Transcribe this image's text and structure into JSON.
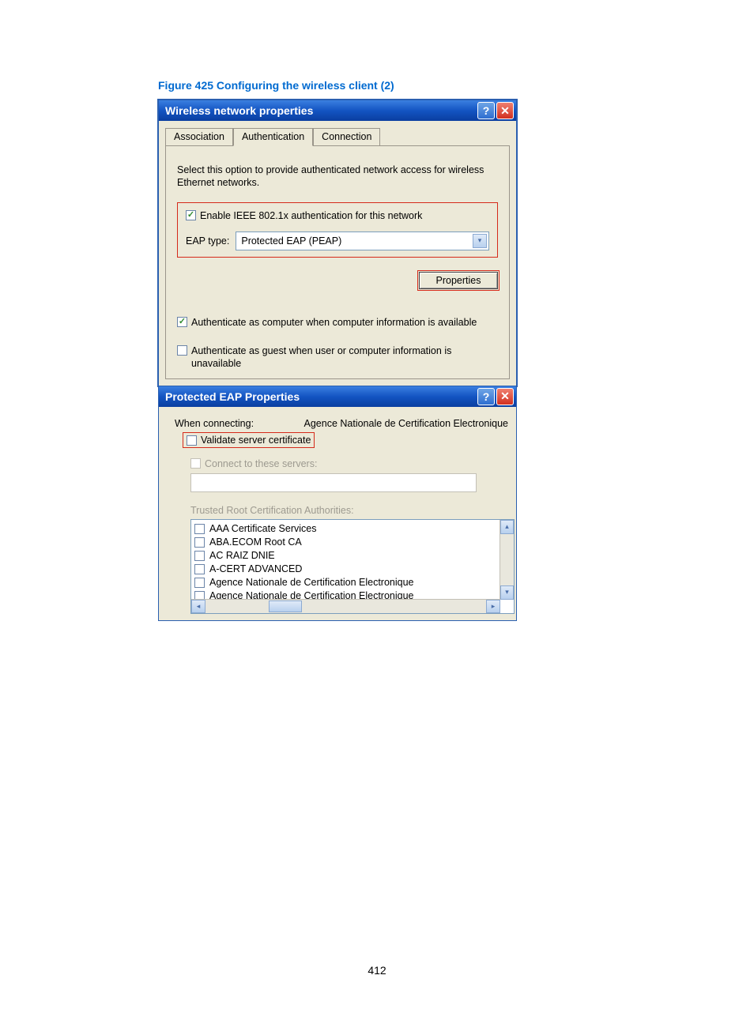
{
  "figure_caption": "Figure 425 Configuring the wireless client (2)",
  "window1": {
    "title": "Wireless network properties",
    "tabs": {
      "association": "Association",
      "authentication": "Authentication",
      "connection": "Connection"
    },
    "description": "Select this option to provide authenticated network access for wireless Ethernet networks.",
    "enable_8021x_label": "Enable IEEE 802.1x authentication for this network",
    "eap_type_label": "EAP type:",
    "eap_type_value": "Protected EAP (PEAP)",
    "properties_button": "Properties",
    "auth_as_computer_label": "Authenticate as computer when computer information is available",
    "auth_as_guest_label": "Authenticate as guest when user or computer information is unavailable"
  },
  "window2": {
    "title": "Protected EAP Properties",
    "when_connecting_label": "When connecting:",
    "when_connecting_extra": "Agence Nationale de Certification Electronique",
    "validate_label": "Validate server certificate",
    "connect_servers_label": "Connect to these servers:",
    "trusted_label": "Trusted Root Certification Authorities:",
    "ca_list": [
      "AAA Certificate Services",
      "ABA.ECOM Root CA",
      "AC RAIZ DNIE",
      "A-CERT ADVANCED",
      "Agence Nationale de Certification Electronique",
      "Agence Nationale de Certification Electronique"
    ]
  },
  "page_number": "412"
}
